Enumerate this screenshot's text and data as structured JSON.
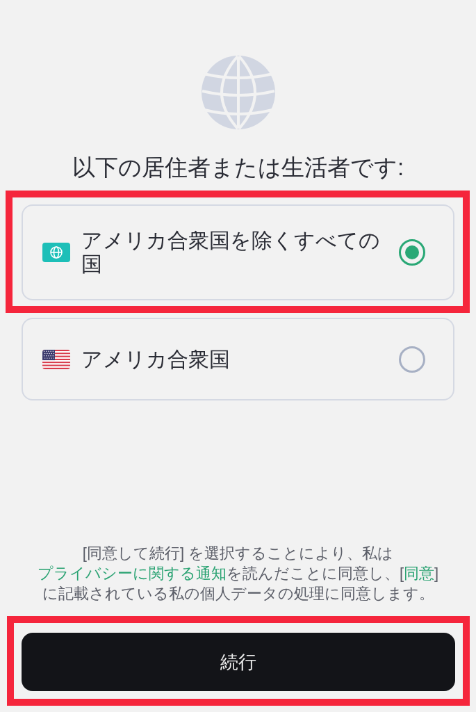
{
  "heading": "以下の居住者または生活者です:",
  "options": [
    {
      "kind": "global",
      "label": "アメリカ合衆国を除くすべての国",
      "selected": true,
      "highlighted": true
    },
    {
      "kind": "country",
      "label": "アメリカ合衆国",
      "selected": false,
      "highlighted": false
    }
  ],
  "consent": [
    {
      "kind": "text",
      "text": "[同意して続行] を選択することにより、私は"
    },
    {
      "kind": "link",
      "text": "プライバシーに関する通知"
    },
    {
      "kind": "text",
      "text": "を読んだことに同意し、["
    },
    {
      "kind": "link",
      "text": "同意"
    },
    {
      "kind": "text",
      "text": "] に記載されている私の個人データの処理に同意します。"
    }
  ],
  "continue_button": {
    "label": "続行",
    "highlighted": true
  }
}
